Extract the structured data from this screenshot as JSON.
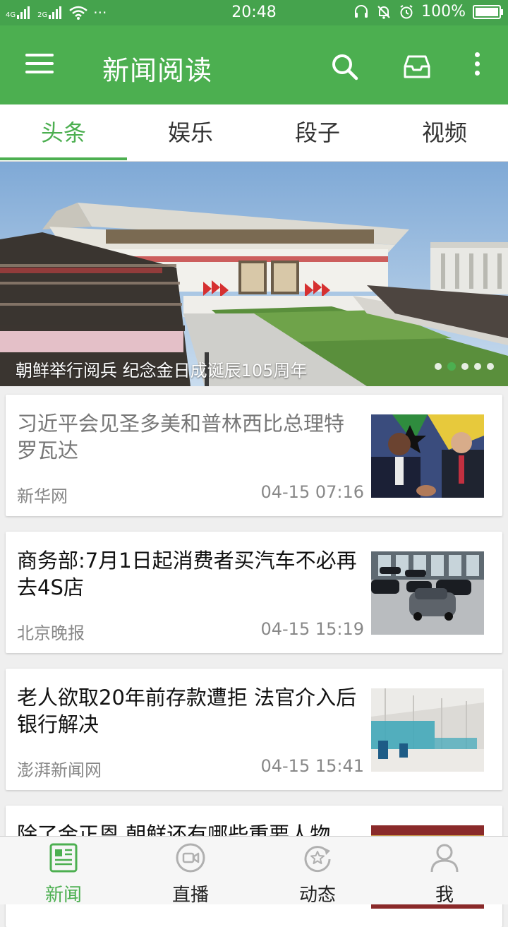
{
  "status_bar": {
    "network_1": "4G",
    "network_2": "2G",
    "more": "···",
    "time": "20:48",
    "battery": "100%",
    "battery_level": 1.0
  },
  "app_bar": {
    "title": "新闻阅读",
    "icons": [
      "menu-icon",
      "search-icon",
      "inbox-icon",
      "more-vert-icon"
    ]
  },
  "tabs": [
    {
      "label": "头条",
      "active": true
    },
    {
      "label": "娱乐",
      "active": false
    },
    {
      "label": "段子",
      "active": false
    },
    {
      "label": "视频",
      "active": false
    }
  ],
  "banner": {
    "caption": "朝鲜举行阅兵 纪念金日成诞辰105周年",
    "slide_count": 5,
    "active_slide": 2
  },
  "news": [
    {
      "title": "习近平会见圣多美和普林西比总理特罗瓦达",
      "source": "新华网",
      "time": "04-15 07:16",
      "read": true
    },
    {
      "title": "商务部:7月1日起消费者买汽车不必再去4S店",
      "source": "北京晚报",
      "time": "04-15 15:19",
      "read": false
    },
    {
      "title": "老人欲取20年前存款遭拒 法官介入后银行解决",
      "source": "澎湃新闻网",
      "time": "04-15 15:41",
      "read": false
    },
    {
      "title": "除了金正恩 朝鲜还有哪些重要人物",
      "source": "",
      "time": "",
      "read": false
    }
  ],
  "bottom_nav": [
    {
      "label": "新闻",
      "icon": "newspaper-icon",
      "active": true
    },
    {
      "label": "直播",
      "icon": "video-icon",
      "active": false
    },
    {
      "label": "动态",
      "icon": "star-refresh-icon",
      "active": false
    },
    {
      "label": "我",
      "icon": "person-icon",
      "active": false
    }
  ],
  "colors": {
    "primary": "#4caf50",
    "status_bar": "#45a34d",
    "text_primary": "#111111",
    "text_secondary": "#888888"
  }
}
